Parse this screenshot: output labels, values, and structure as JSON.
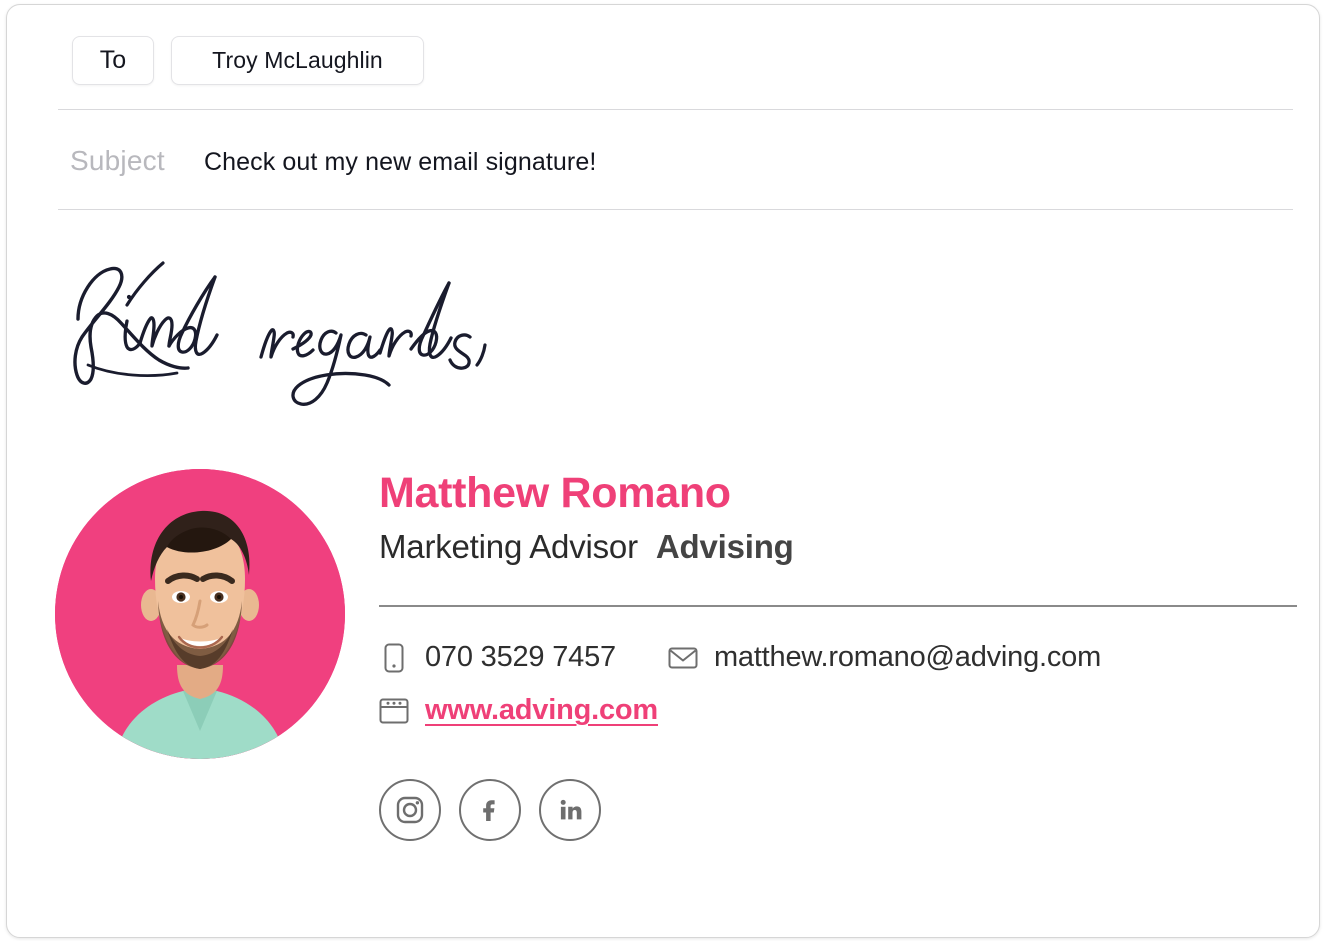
{
  "compose": {
    "to": {
      "label": "To",
      "recipient": "Troy McLaughlin"
    },
    "subject": {
      "label": "Subject",
      "value": "Check out my new email signature!"
    },
    "body": {
      "signoff_script": "Kind regards,"
    }
  },
  "signature": {
    "avatar_alt": "Matthew Romano portrait",
    "name": "Matthew Romano",
    "role": "Marketing Advisor",
    "company": "Advising",
    "contacts": {
      "phone": {
        "icon": "mobile-phone-icon",
        "value": "070 3529 7457"
      },
      "email": {
        "icon": "envelope-icon",
        "value": "matthew.romano@adving.com"
      },
      "website": {
        "icon": "browser-window-icon",
        "value": "www.adving.com"
      }
    },
    "social": [
      {
        "icon": "instagram-icon",
        "label": "Instagram"
      },
      {
        "icon": "facebook-icon",
        "label": "Facebook"
      },
      {
        "icon": "linkedin-icon",
        "label": "LinkedIn"
      }
    ]
  },
  "colors": {
    "accent_pink": "#ef4078",
    "avatar_pink": "#f0407f",
    "script_ink": "#1a1c2e",
    "text_dark": "#2b2b2b",
    "company_gray": "#444444",
    "icon_gray": "#6e6e6e",
    "placeholder_gray": "#b8b8bd",
    "divider_gray": "#d9d9dc"
  }
}
